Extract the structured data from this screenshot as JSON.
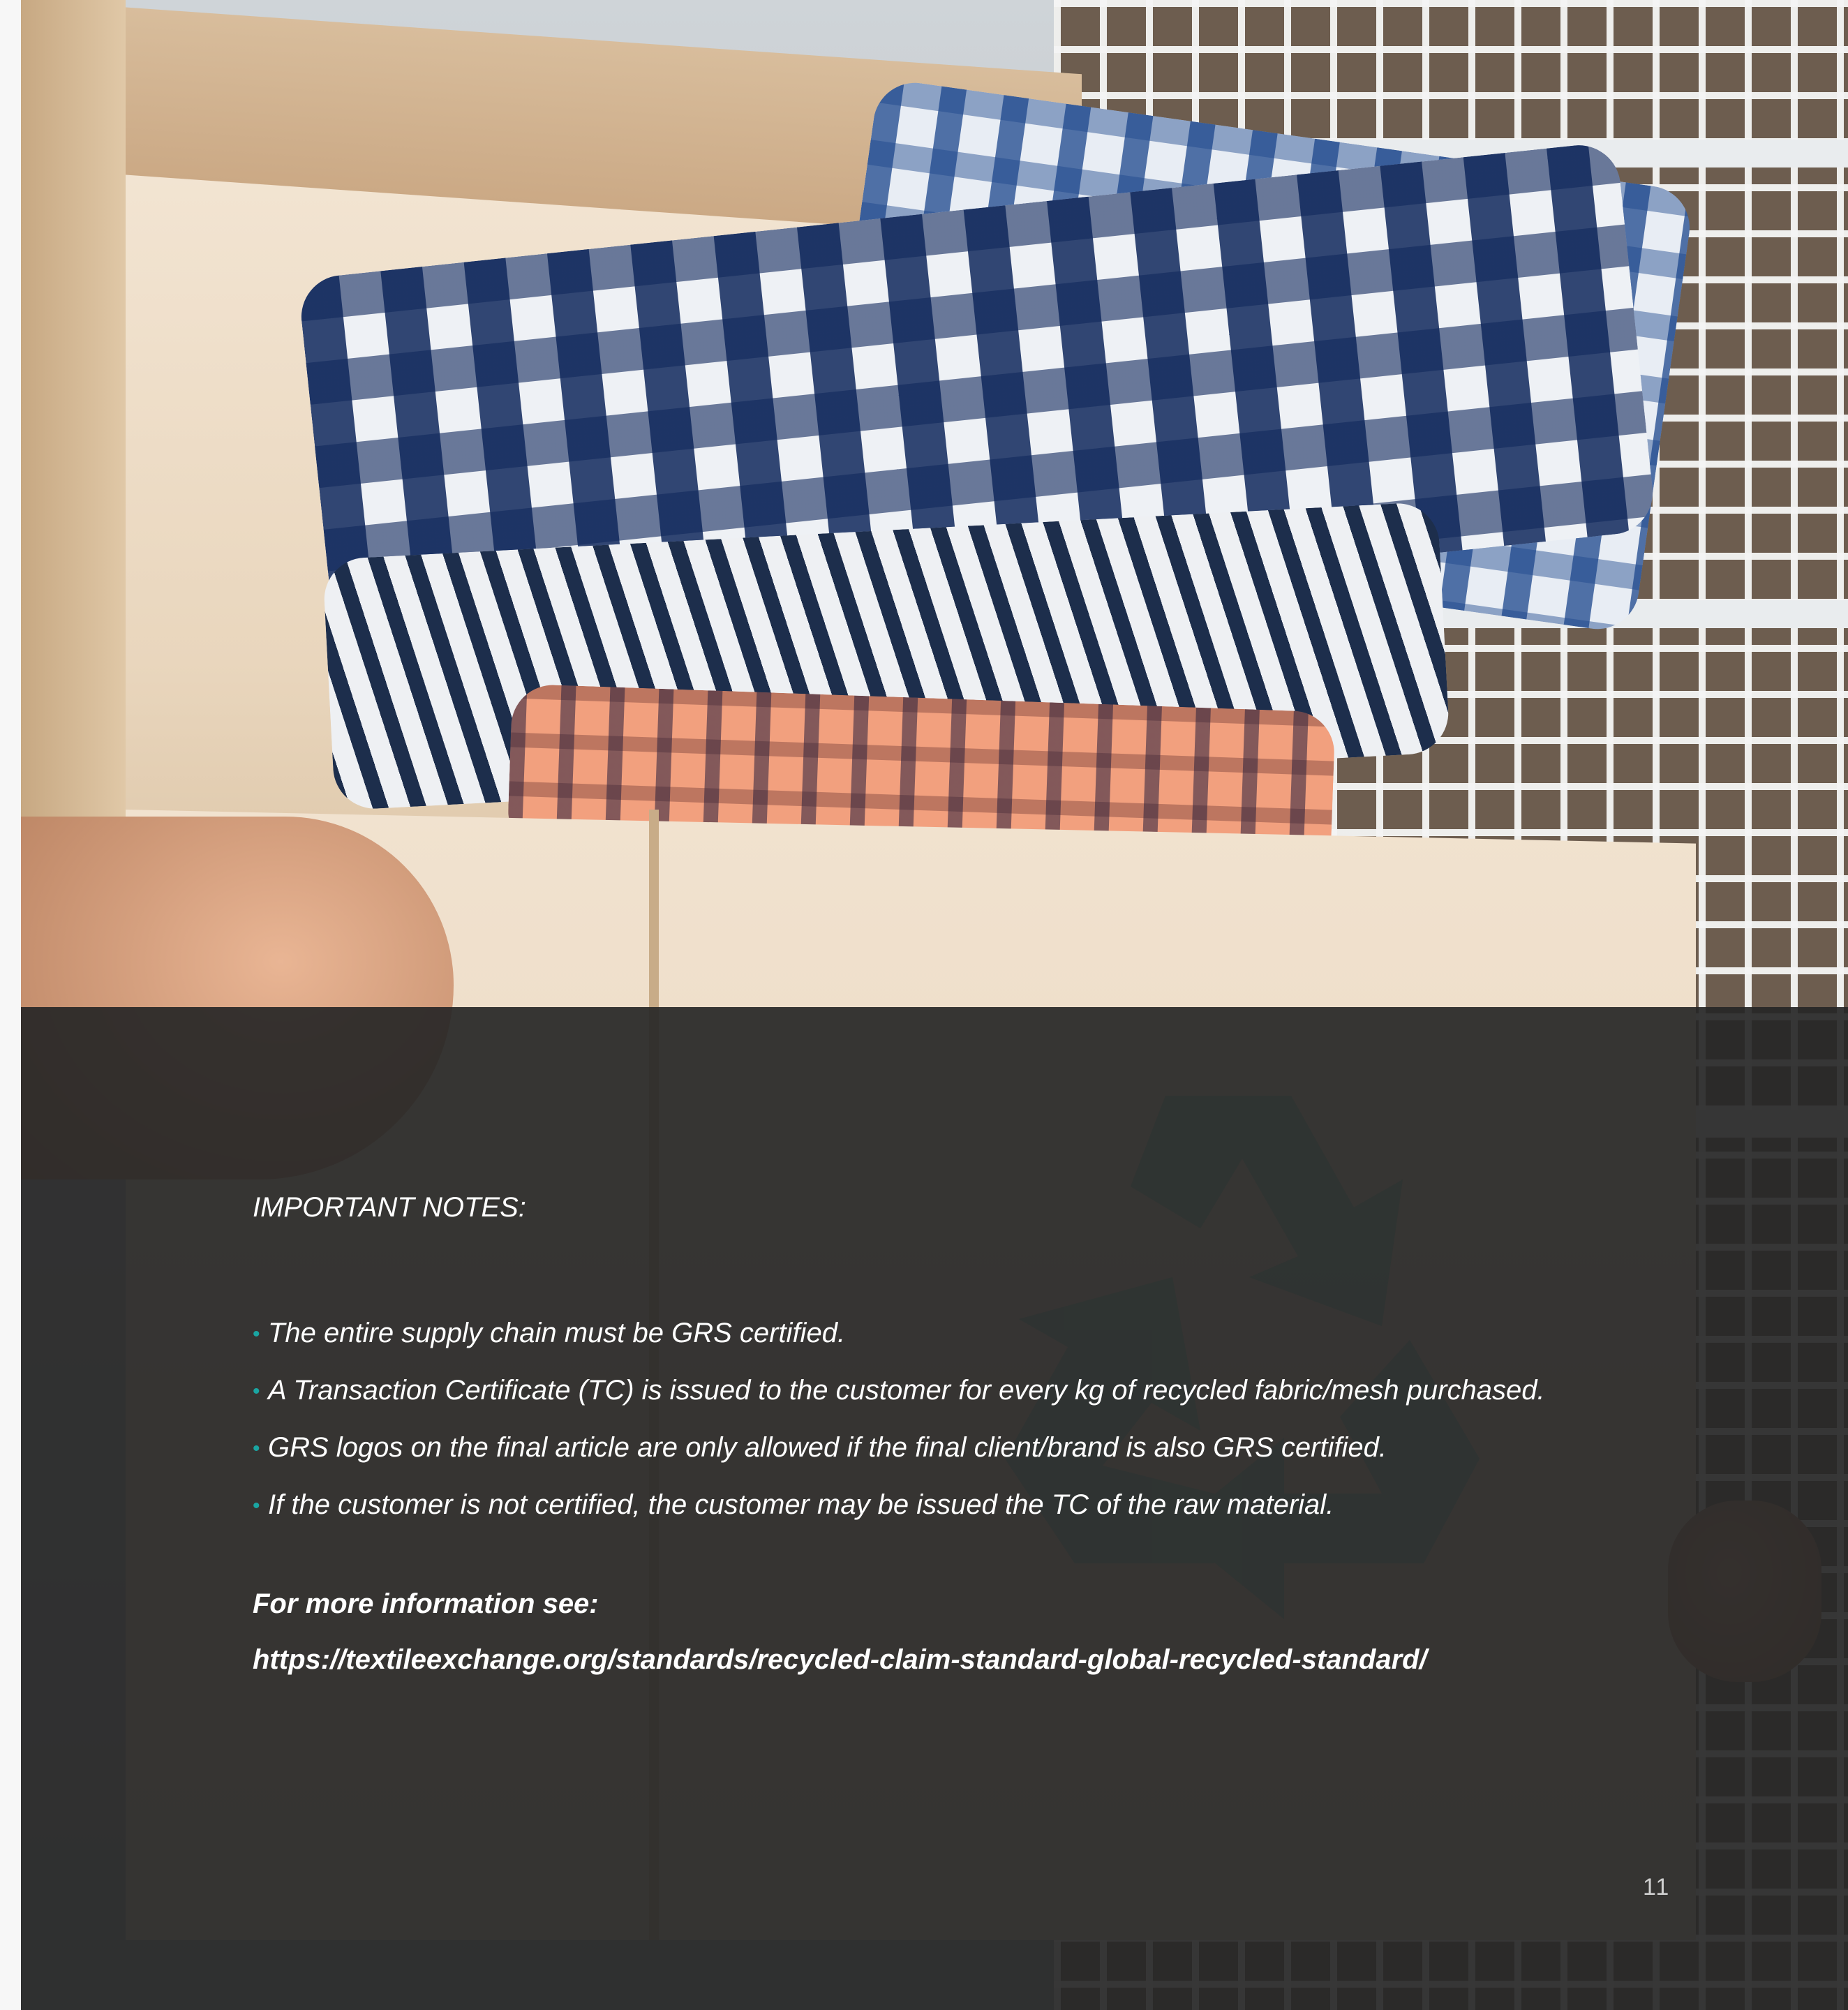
{
  "notes": {
    "title": "IMPORTANT NOTES:",
    "items": [
      "The entire supply chain must be GRS certified.",
      "A Transaction Certificate (TC) is issued to the customer for every kg of recycled fabric/mesh purchased.",
      "GRS logos on the final article are only allowed if the final client/brand is also GRS certified.",
      "If the customer is not certified, the customer may be issued the TC of the raw material."
    ],
    "bullet": "•"
  },
  "more_info": {
    "label": "For more information see:",
    "url": "https://textileexchange.org/standards/recycled-claim-standard-global-recycled-standard/"
  },
  "page_number": "11",
  "colors": {
    "panel": "#262626",
    "bullet_accent": "#1aa5a2",
    "text": "#ffffff",
    "recycle_symbol": "#2e3432"
  },
  "icons": {
    "watermark": "recycle-icon"
  }
}
